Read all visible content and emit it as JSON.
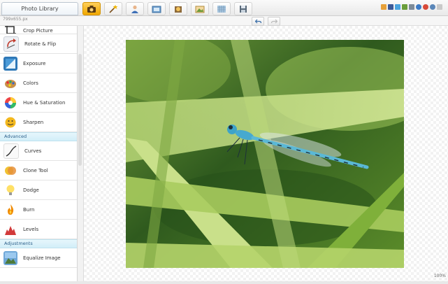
{
  "header": {
    "photo_library_tab": "Photo Library"
  },
  "toolbar": {
    "tabs": [
      {
        "icon": "camera-icon",
        "active": true
      },
      {
        "icon": "magic-wand-icon",
        "active": false
      },
      {
        "icon": "person-icon",
        "active": false
      },
      {
        "icon": "frame-icon",
        "active": false
      },
      {
        "icon": "stickers-icon",
        "active": false
      },
      {
        "icon": "picture-icon",
        "active": false
      },
      {
        "icon": "texture-icon",
        "active": false
      },
      {
        "icon": "save-icon",
        "active": false
      }
    ],
    "social_icons": [
      "home-icon",
      "facebook-icon",
      "twitter-icon",
      "share-icon",
      "email-icon",
      "help-icon",
      "settings-icon",
      "info-icon",
      "close-icon"
    ]
  },
  "subbar": {
    "image_size": "799x655.px",
    "undo_icon": "undo-icon",
    "redo_icon": "redo-icon"
  },
  "sidebar": {
    "items": [
      {
        "label": "Crop Picture",
        "icon": "crop-icon"
      },
      {
        "label": "Rotate & Flip",
        "icon": "rotate-icon"
      },
      {
        "label": "Exposure",
        "icon": "exposure-icon"
      },
      {
        "label": "Colors",
        "icon": "colors-icon"
      },
      {
        "label": "Hue & Saturation",
        "icon": "hue-saturation-icon"
      },
      {
        "label": "Sharpen",
        "icon": "sharpen-icon"
      }
    ],
    "advanced_header": "Advanced",
    "advanced_items": [
      {
        "label": "Curves",
        "icon": "curves-icon"
      },
      {
        "label": "Clone Tool",
        "icon": "clone-icon"
      },
      {
        "label": "Dodge",
        "icon": "dodge-icon"
      },
      {
        "label": "Burn",
        "icon": "burn-icon"
      },
      {
        "label": "Levels",
        "icon": "levels-icon"
      }
    ],
    "adjustments_header": "Adjustments",
    "adjustments_items": [
      {
        "label": "Equalize Image",
        "icon": "equalize-icon"
      }
    ]
  },
  "canvas": {
    "zoom_label": "100%",
    "photo_subject": "dragonfly-on-grass-photo"
  },
  "colors": {
    "accent_tab": "#f5b21a",
    "section_header": "#d8f0f9",
    "section_text": "#2b5f8a"
  }
}
